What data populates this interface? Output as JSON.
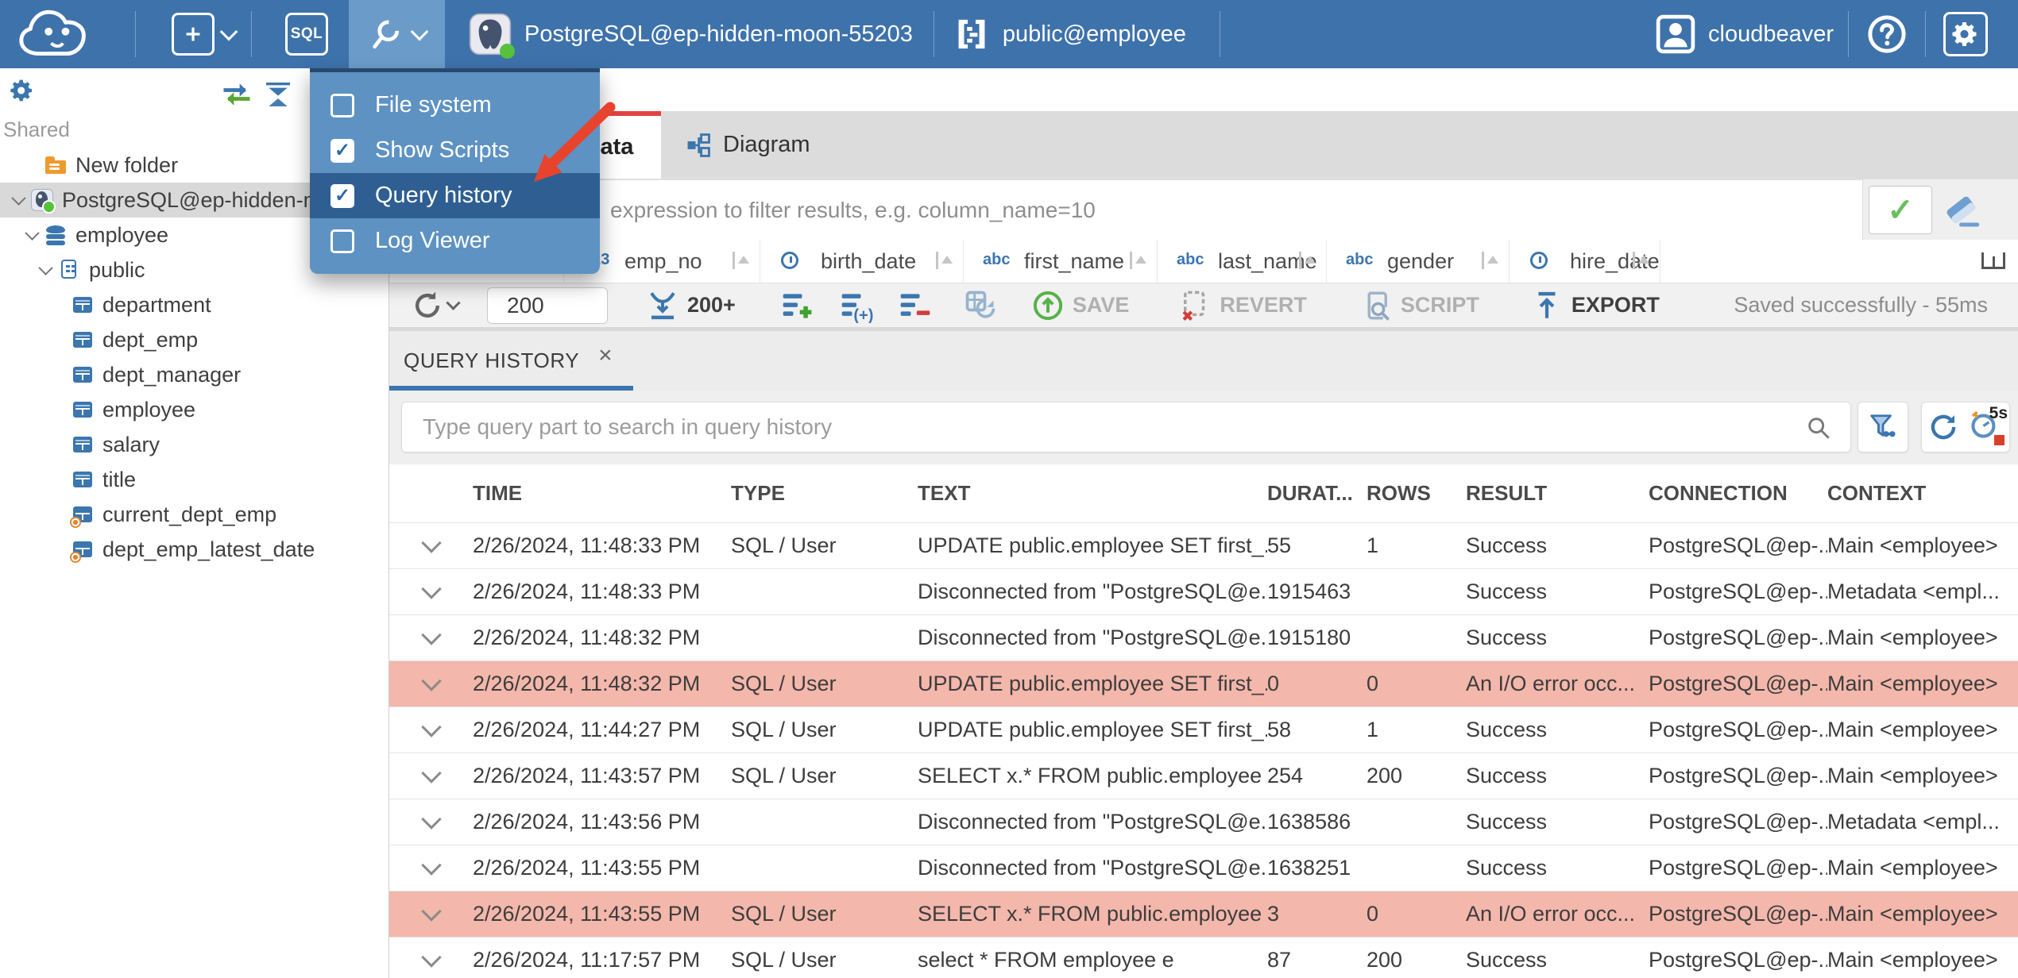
{
  "colors": {
    "topbar": "#3e72ab",
    "topbar_active": "#6b9cc9",
    "menu": "#5e92c3",
    "menu_highlight": "#2f5f92",
    "accent": "#3b76af",
    "error_row": "#f4b7ab",
    "tab_indicator": "#e04343",
    "status_dot": "#57c13d",
    "arrow": "#e8432c"
  },
  "topbar": {
    "sql_label": "SQL",
    "connection_label": "PostgreSQL@ep-hidden-moon-55203",
    "schema_label": "public@employee",
    "user_label": "cloudbeaver"
  },
  "menu": {
    "items": [
      {
        "label": "File system",
        "checked": false,
        "highlighted": false
      },
      {
        "label": "Show Scripts",
        "checked": true,
        "highlighted": false
      },
      {
        "label": "Query history",
        "checked": true,
        "highlighted": true
      },
      {
        "label": "Log Viewer",
        "checked": false,
        "highlighted": false
      }
    ]
  },
  "sidebar": {
    "section_label": "Shared",
    "tree": [
      {
        "label": "New folder",
        "icon": "folder",
        "level": 1,
        "chevron": false,
        "selected": false
      },
      {
        "label": "PostgreSQL@ep-hidden-moon-55203",
        "icon": "postgres",
        "level": 0,
        "chevron": true,
        "selected": true
      },
      {
        "label": "employee",
        "icon": "database",
        "level": 1,
        "chevron": true,
        "selected": false
      },
      {
        "label": "public",
        "icon": "schema",
        "level": 2,
        "chevron": true,
        "selected": false
      },
      {
        "label": "department",
        "icon": "table",
        "level": 3,
        "chevron": false,
        "selected": false
      },
      {
        "label": "dept_emp",
        "icon": "table",
        "level": 3,
        "chevron": false,
        "selected": false
      },
      {
        "label": "dept_manager",
        "icon": "table",
        "level": 3,
        "chevron": false,
        "selected": false
      },
      {
        "label": "employee",
        "icon": "table",
        "level": 3,
        "chevron": false,
        "selected": false
      },
      {
        "label": "salary",
        "icon": "table",
        "level": 3,
        "chevron": false,
        "selected": false
      },
      {
        "label": "title",
        "icon": "table",
        "level": 3,
        "chevron": false,
        "selected": false
      },
      {
        "label": "current_dept_emp",
        "icon": "view",
        "level": 3,
        "chevron": false,
        "selected": false
      },
      {
        "label": "dept_emp_latest_date",
        "icon": "view",
        "level": 3,
        "chevron": false,
        "selected": false
      }
    ]
  },
  "main": {
    "tabs": {
      "data_label": "Data",
      "diagram_label": "Diagram"
    },
    "filter": {
      "placeholder": "expression to filter results, e.g. column_name=10"
    },
    "grid_columns": [
      {
        "icon": "grid",
        "label": "#",
        "sort": false
      },
      {
        "icon": "num",
        "label": "emp_no",
        "sort": true
      },
      {
        "icon": "clock",
        "label": "birth_date",
        "sort": true
      },
      {
        "icon": "abc",
        "label": "first_name",
        "sort": true
      },
      {
        "icon": "abc",
        "label": "last_name",
        "sort": true
      },
      {
        "icon": "abc",
        "label": "gender",
        "sort": true
      },
      {
        "icon": "clock",
        "label": "hire_date",
        "sort": true
      }
    ],
    "toolbar": {
      "rows_value": "200",
      "fetch_label": "200+",
      "save_label": "SAVE",
      "revert_label": "REVERT",
      "script_label": "SCRIPT",
      "export_label": "EXPORT",
      "status": "Saved successfully - 55ms"
    }
  },
  "history": {
    "tab_label": "QUERY HISTORY",
    "close_glyph": "×",
    "search_placeholder": "Type query part to search in query history",
    "timer_label": "5s",
    "columns": [
      "TIME",
      "TYPE",
      "TEXT",
      "DURAT...",
      "ROWS",
      "RESULT",
      "CONNECTION",
      "CONTEXT"
    ],
    "rows": [
      {
        "time": "2/26/2024, 11:48:33 PM",
        "type": "SQL / User",
        "text": "UPDATE public.employee SET first_...",
        "duration": "55",
        "rowcount": "1",
        "result": "Success",
        "connection": "PostgreSQL@ep-...",
        "context": "Main <employee>",
        "error": false
      },
      {
        "time": "2/26/2024, 11:48:33 PM",
        "type": "",
        "text": "Disconnected from \"PostgreSQL@e...",
        "duration": "1915463",
        "rowcount": "",
        "result": "Success",
        "connection": "PostgreSQL@ep-...",
        "context": "Metadata <empl...",
        "error": false
      },
      {
        "time": "2/26/2024, 11:48:32 PM",
        "type": "",
        "text": "Disconnected from \"PostgreSQL@e...",
        "duration": "1915180",
        "rowcount": "",
        "result": "Success",
        "connection": "PostgreSQL@ep-...",
        "context": "Main <employee>",
        "error": false
      },
      {
        "time": "2/26/2024, 11:48:32 PM",
        "type": "SQL / User",
        "text": "UPDATE public.employee SET first_...",
        "duration": "0",
        "rowcount": "0",
        "result": "An I/O error occ...",
        "connection": "PostgreSQL@ep-...",
        "context": "Main <employee>",
        "error": true
      },
      {
        "time": "2/26/2024, 11:44:27 PM",
        "type": "SQL / User",
        "text": "UPDATE public.employee SET first_...",
        "duration": "58",
        "rowcount": "1",
        "result": "Success",
        "connection": "PostgreSQL@ep-...",
        "context": "Main <employee>",
        "error": false
      },
      {
        "time": "2/26/2024, 11:43:57 PM",
        "type": "SQL / User",
        "text": "SELECT x.* FROM public.employee x",
        "duration": "254",
        "rowcount": "200",
        "result": "Success",
        "connection": "PostgreSQL@ep-...",
        "context": "Main <employee>",
        "error": false
      },
      {
        "time": "2/26/2024, 11:43:56 PM",
        "type": "",
        "text": "Disconnected from \"PostgreSQL@e...",
        "duration": "1638586",
        "rowcount": "",
        "result": "Success",
        "connection": "PostgreSQL@ep-...",
        "context": "Metadata <empl...",
        "error": false
      },
      {
        "time": "2/26/2024, 11:43:55 PM",
        "type": "",
        "text": "Disconnected from \"PostgreSQL@e...",
        "duration": "1638251",
        "rowcount": "",
        "result": "Success",
        "connection": "PostgreSQL@ep-...",
        "context": "Main <employee>",
        "error": false
      },
      {
        "time": "2/26/2024, 11:43:55 PM",
        "type": "SQL / User",
        "text": "SELECT x.* FROM public.employee x",
        "duration": "3",
        "rowcount": "0",
        "result": "An I/O error occ...",
        "connection": "PostgreSQL@ep-...",
        "context": "Main <employee>",
        "error": true
      },
      {
        "time": "2/26/2024, 11:17:57 PM",
        "type": "SQL / User",
        "text": "select * FROM employee e",
        "duration": "87",
        "rowcount": "200",
        "result": "Success",
        "connection": "PostgreSQL@ep-...",
        "context": "Main <employee>",
        "error": false
      }
    ]
  }
}
